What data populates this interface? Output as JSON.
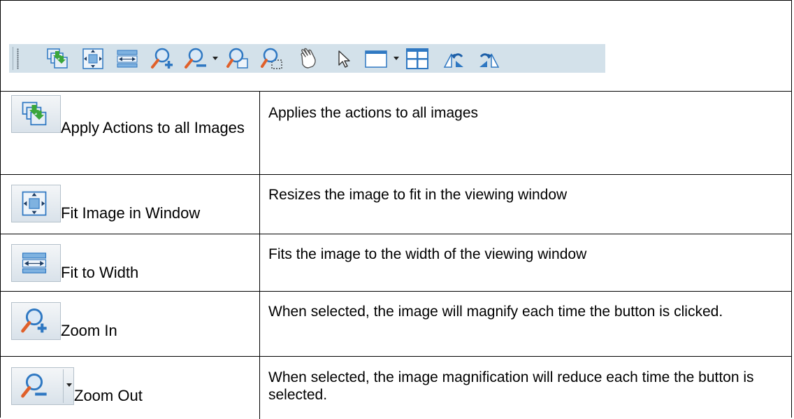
{
  "toolbar": {
    "buttons": [
      {
        "icon": "apply-actions-all-icon"
      },
      {
        "icon": "fit-window-icon"
      },
      {
        "icon": "fit-width-icon"
      },
      {
        "icon": "zoom-in-icon"
      },
      {
        "icon": "zoom-out-icon",
        "has_dropdown": true
      },
      {
        "icon": "zoom-rect-icon"
      },
      {
        "icon": "zoom-select-icon"
      },
      {
        "icon": "pan-hand-icon"
      },
      {
        "icon": "pointer-icon"
      },
      {
        "icon": "window-icon",
        "has_dropdown": true
      },
      {
        "icon": "grid-layout-icon"
      },
      {
        "icon": "rotate-left-icon"
      },
      {
        "icon": "rotate-right-icon"
      }
    ]
  },
  "rows": [
    {
      "label": "Apply Actions to all Images",
      "description": "Applies the actions to all images",
      "icon": "apply-actions-all-icon"
    },
    {
      "label": "Fit Image in Window",
      "description": "Resizes the image to fit in the viewing window",
      "icon": "fit-window-icon"
    },
    {
      "label": "Fit to Width",
      "description": "Fits the image to the width of the viewing window",
      "icon": "fit-width-icon"
    },
    {
      "label": "Zoom In",
      "description": "When selected, the image will magnify each time the button is clicked.",
      "icon": "zoom-in-icon"
    },
    {
      "label": "Zoom Out",
      "description": "When selected, the image magnification will reduce each time the button is selected.",
      "icon": "zoom-out-icon"
    }
  ],
  "colors": {
    "toolbar_bg": "#d3e1ea",
    "icon_blue": "#2f78c2",
    "icon_green": "#3aa63a",
    "zoom_handle": "#e0602a"
  }
}
